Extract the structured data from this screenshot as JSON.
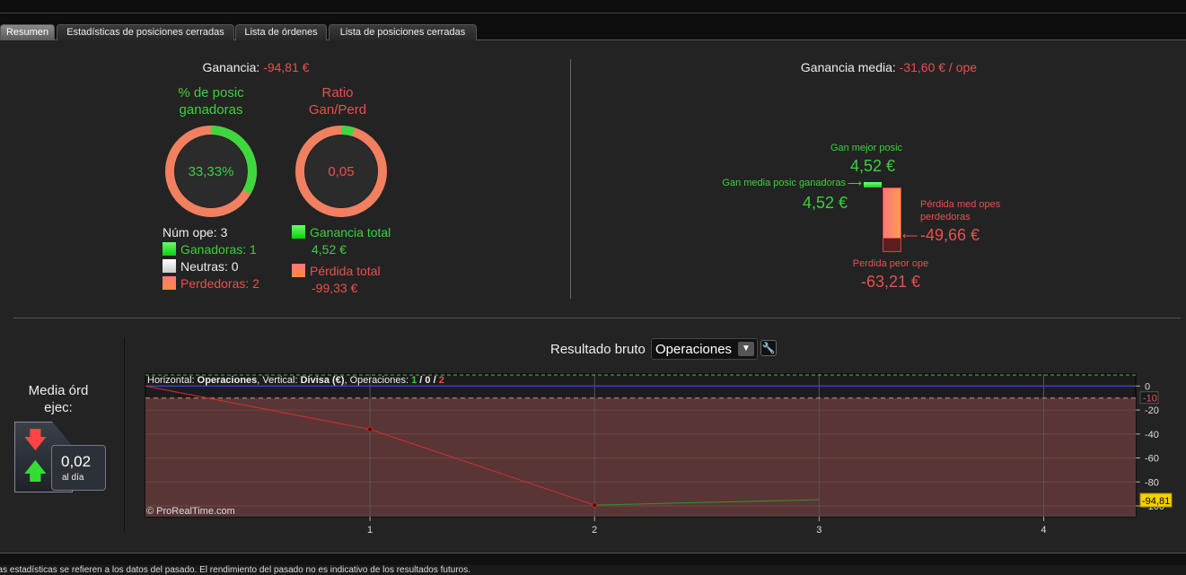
{
  "tabs": [
    {
      "label": "Resumen",
      "active": true
    },
    {
      "label": "Estadísticas de posiciones cerradas"
    },
    {
      "label": "Lista de órdenes"
    },
    {
      "label": "Lista de posiciones cerradas"
    }
  ],
  "summary": {
    "ganancia_label": "Ganancia:",
    "ganancia_value": "-94,81 €",
    "win_pct_title": "% de posic ganadoras",
    "win_pct_value": "33,33%",
    "win_pct_fraction": 0.3333,
    "ratio_title": "Ratio Gan/Perd",
    "ratio_value": "0,05",
    "ratio_fraction": 0.048,
    "num_ope": "Núm ope: 3",
    "ganadoras": "Ganadoras: 1",
    "neutras": "Neutras: 0",
    "perdedoras": "Perdedoras: 2",
    "ganancia_total_label": "Ganancia total",
    "ganancia_total_value": "4,52 €",
    "perdida_total_label": "Pérdida total",
    "perdida_total_value": "-99,33 €"
  },
  "average": {
    "title_label": "Ganancia media:",
    "title_value": "-31,60 € / ope",
    "best_label": "Gan mejor posic",
    "best_value": "4,52 €",
    "avg_win_label": "Gan media posic ganadoras",
    "avg_win_value": "4,52 €",
    "avg_loss_label": "Pérdida med opes perdedoras",
    "avg_loss_value": "-49,66 €",
    "worst_label": "Perdida peor ope",
    "worst_value": "-63,21 €"
  },
  "orders": {
    "title": "Media órd ejec:",
    "value": "0,02",
    "unit": "al día"
  },
  "chart_header": {
    "label": "Resultado bruto",
    "select_value": "Operaciones"
  },
  "chart_data": {
    "type": "line",
    "info": {
      "h_label": "Horizontal: ",
      "h_value": "Operaciones",
      "v_label": ", Vertical: ",
      "v_value": "Divisa (€)",
      "ops_label": ", Operaciones: ",
      "wins": "1",
      "neutral": "0",
      "losses": "2"
    },
    "x": [
      0,
      1,
      2,
      3
    ],
    "y": [
      0,
      -36.12,
      -99.33,
      -94.81
    ],
    "segment_colors": [
      "#d03030",
      "#d03030",
      "#2a9a2a"
    ],
    "xticks": [
      "1",
      "2",
      "3",
      "4"
    ],
    "xtick_values": [
      1,
      2,
      3,
      4
    ],
    "yticks": [
      "0",
      "-20",
      "-40",
      "-60",
      "-80",
      "-100"
    ],
    "ytick_values": [
      0,
      -20,
      -40,
      -60,
      -80,
      -100
    ],
    "xlim": [
      0,
      4.41
    ],
    "ylim": [
      -109,
      10
    ],
    "ref_line": {
      "value": -10,
      "label": "-10"
    },
    "last_value_label": "-94,81",
    "watermark": "© ProRealTime.com",
    "grid": true
  },
  "footer": "Las estadísticas se refieren a los datos del pasado. El rendimiento del pasado no es indicativo de los resultados futuros."
}
